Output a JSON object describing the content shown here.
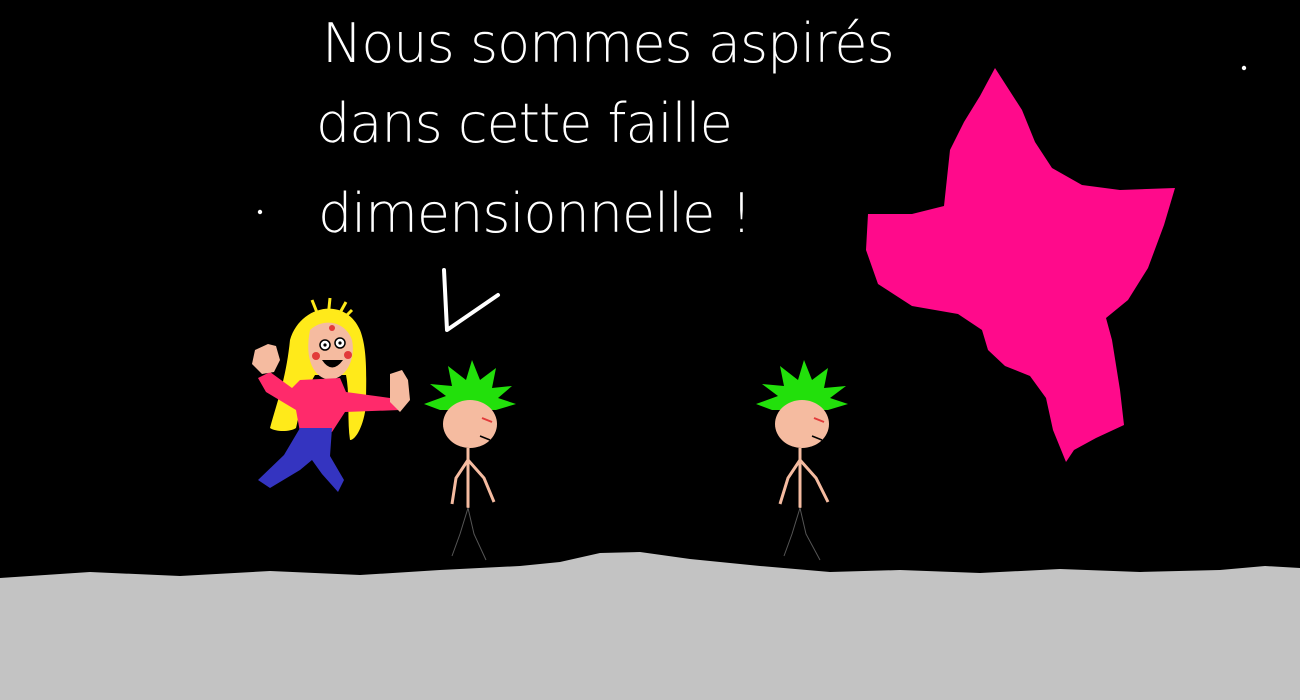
{
  "scene": {
    "speech": {
      "line1": "Nous sommes aspirés",
      "line2": "dans cette faille",
      "line3": "dimensionnelle !"
    }
  },
  "colors": {
    "sky": "#000000",
    "ground": "#c3c3c3",
    "rift": "#ff0a8b",
    "hair_green": "#22e00b",
    "hair_blonde": "#ffea1a",
    "skin": "#f5bba0",
    "shirt": "#ff2a6b",
    "jeans": "#3434c0",
    "text": "#ffffff"
  },
  "icons": [
    "star-icon",
    "pink-rift-icon",
    "speech-pointer-icon"
  ]
}
